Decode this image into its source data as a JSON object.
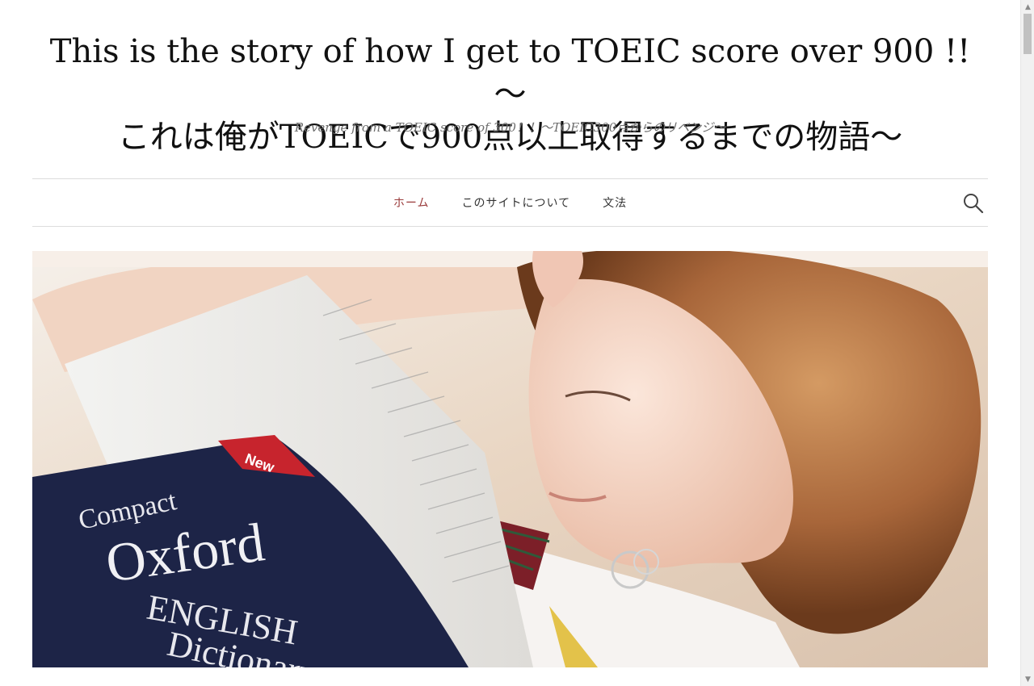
{
  "header": {
    "title_line1": "This is the story of how I get to TOEIC score over 900 !! ～",
    "title_line2": "これは俺がTOEICで900点以上取得するまでの物語～",
    "tagline": "Revenge from a TOEIC score of 300！！～TOEIC300点からのリベンジ～"
  },
  "nav": {
    "items": [
      {
        "label": "ホーム",
        "active": true
      },
      {
        "label": "このサイトについて",
        "active": false
      },
      {
        "label": "文法",
        "active": false
      }
    ],
    "search_icon": "search-icon"
  },
  "hero": {
    "book_text": {
      "badge": "New",
      "line1": "Compact",
      "line2": "Oxford",
      "line3": "ENGLISH",
      "line4": "Dictionary"
    }
  },
  "colors": {
    "accent": "#9a3b3b",
    "tagline": "#6d6d6d",
    "divider": "#dcdcdc"
  }
}
